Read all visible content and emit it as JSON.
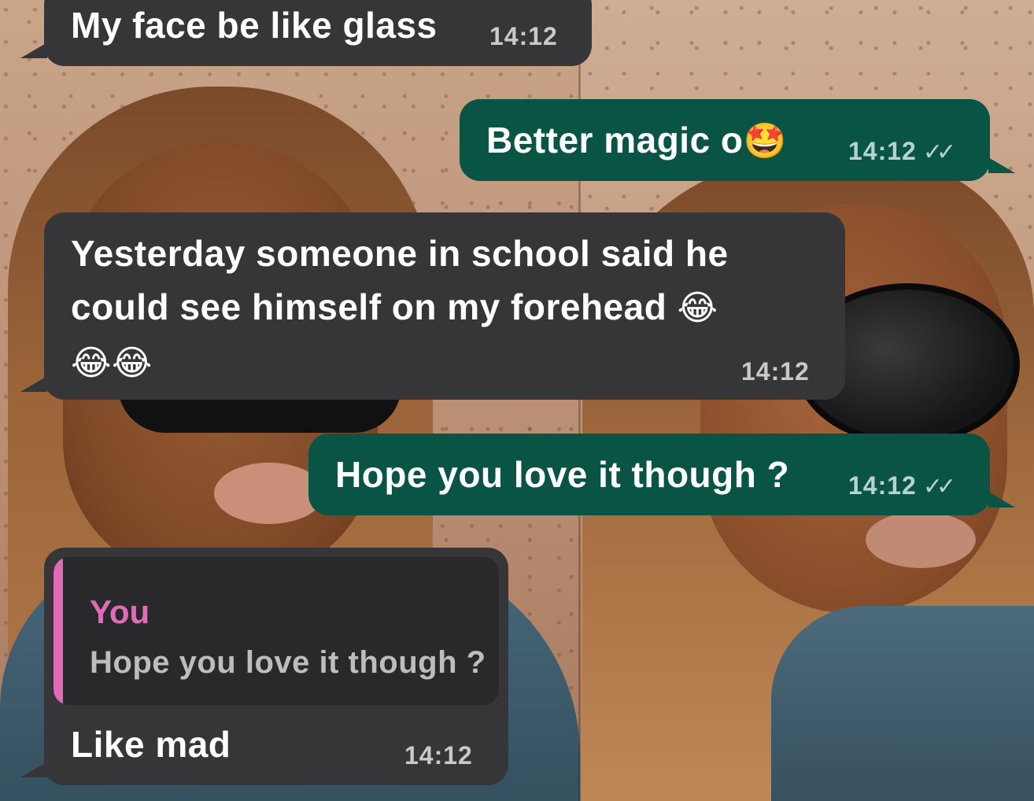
{
  "messages": [
    {
      "direction": "incoming",
      "text": "My face be like glass",
      "time": "14:12"
    },
    {
      "direction": "outgoing",
      "text": "Better magic o",
      "emoji": "🤩",
      "time": "14:12",
      "ticks": "✓✓"
    },
    {
      "direction": "incoming",
      "line1": "Yesterday someone in school said he",
      "line2": "could see himself on my forehead",
      "emoji_inline": "😂",
      "emoji_line3": "😂😂",
      "time": "14:12"
    },
    {
      "direction": "outgoing",
      "text": "Hope you love it though ?",
      "time": "14:12",
      "ticks": "✓✓"
    },
    {
      "direction": "incoming",
      "quote": {
        "author": "You",
        "text": "Hope you love it though ?"
      },
      "text": "Like mad",
      "time": "14:12"
    }
  ],
  "colors": {
    "incoming_bubble": "#363638",
    "outgoing_bubble": "#0a5445",
    "quote_accent": "#e06bb6"
  }
}
